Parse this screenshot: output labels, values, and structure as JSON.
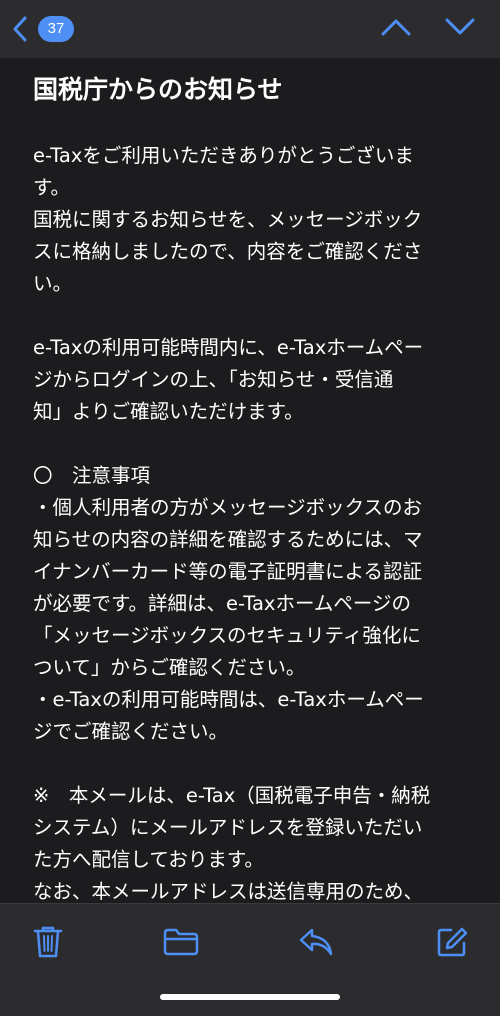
{
  "nav": {
    "unread_count": "37",
    "accent_color": "#4d8ff5"
  },
  "icons": {
    "back": "chevron-left-icon",
    "previous": "chevron-up-icon",
    "next": "chevron-down-icon",
    "trash": "trash-icon",
    "folder": "folder-icon",
    "reply": "reply-icon",
    "compose": "compose-icon"
  },
  "email": {
    "subject": "国税庁からのお知らせ",
    "body": "e-Taxをご利用いただきありがとうございま\nす。\n国税に関するお知らせを、メッセージボック\nスに格納しましたので、内容をご確認くださ\nい。\n\ne-Taxの利用可能時間内に、e-Taxホームペー\nジからログインの上、「お知らせ・受信通\n知」よりご確認いただけます。\n\n〇　注意事項\n・個人利用者の方がメッセージボックスのお\n知らせの内容の詳細を確認するためには、マ\nイナンバーカード等の電子証明書による認証\nが必要です。詳細は、e-Taxホームページの\n「メッセージボックスのセキュリティ強化に\nついて」からご確認ください。\n・e-Taxの利用可能時間は、e-Taxホームペー\nジでご確認ください。\n\n※　本メールは、e-Tax（国税電子申告・納税\nシステム）にメールアドレスを登録いただい\nた方へ配信しております。\nなお、本メールアドレスは送信専用のため、"
  }
}
